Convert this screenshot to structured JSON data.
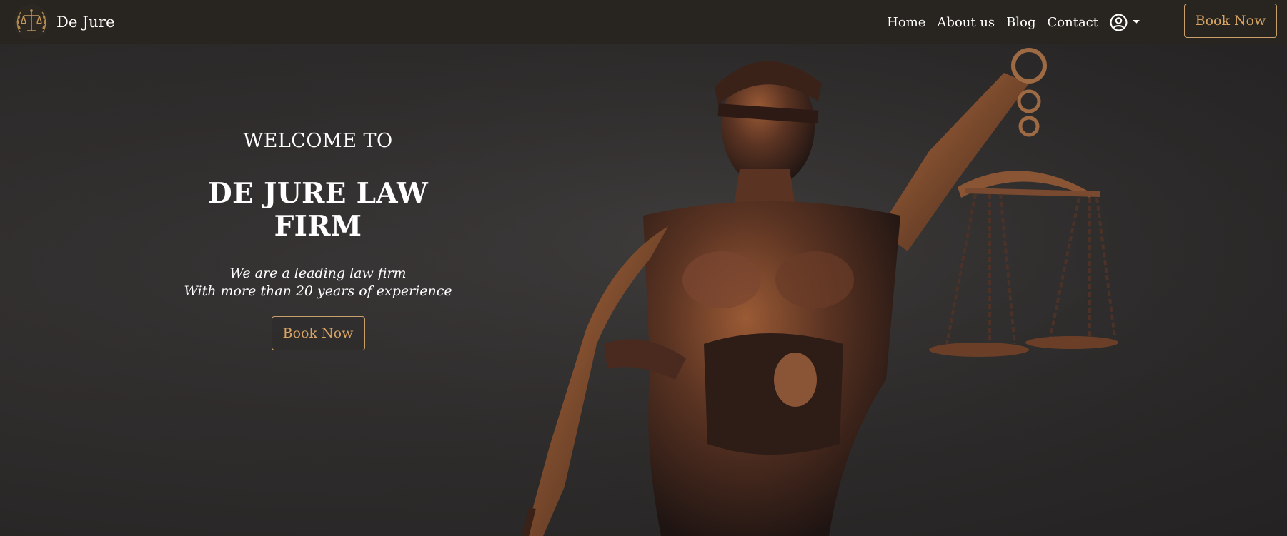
{
  "navbar": {
    "brand_name": "De Jure",
    "logo_icon": "scales-of-justice-laurel-icon",
    "links": [
      {
        "label": "Home"
      },
      {
        "label": "About us"
      },
      {
        "label": "Blog"
      },
      {
        "label": "Contact"
      }
    ],
    "user_icon": "user-circle-icon",
    "book_button": "Book Now"
  },
  "hero": {
    "welcome": "WELCOME TO",
    "title": "DE JURE LAW FIRM",
    "tagline_line1": "We are a leading law firm",
    "tagline_line2": "With more than 20 years of experience",
    "book_button": "Book Now",
    "image_subject": "bronze-lady-justice-statue"
  },
  "colors": {
    "navbar_bg": "#28241f",
    "accent_gold": "#d6a463",
    "hero_bg": "#2e2c2c",
    "text": "#ffffff"
  }
}
